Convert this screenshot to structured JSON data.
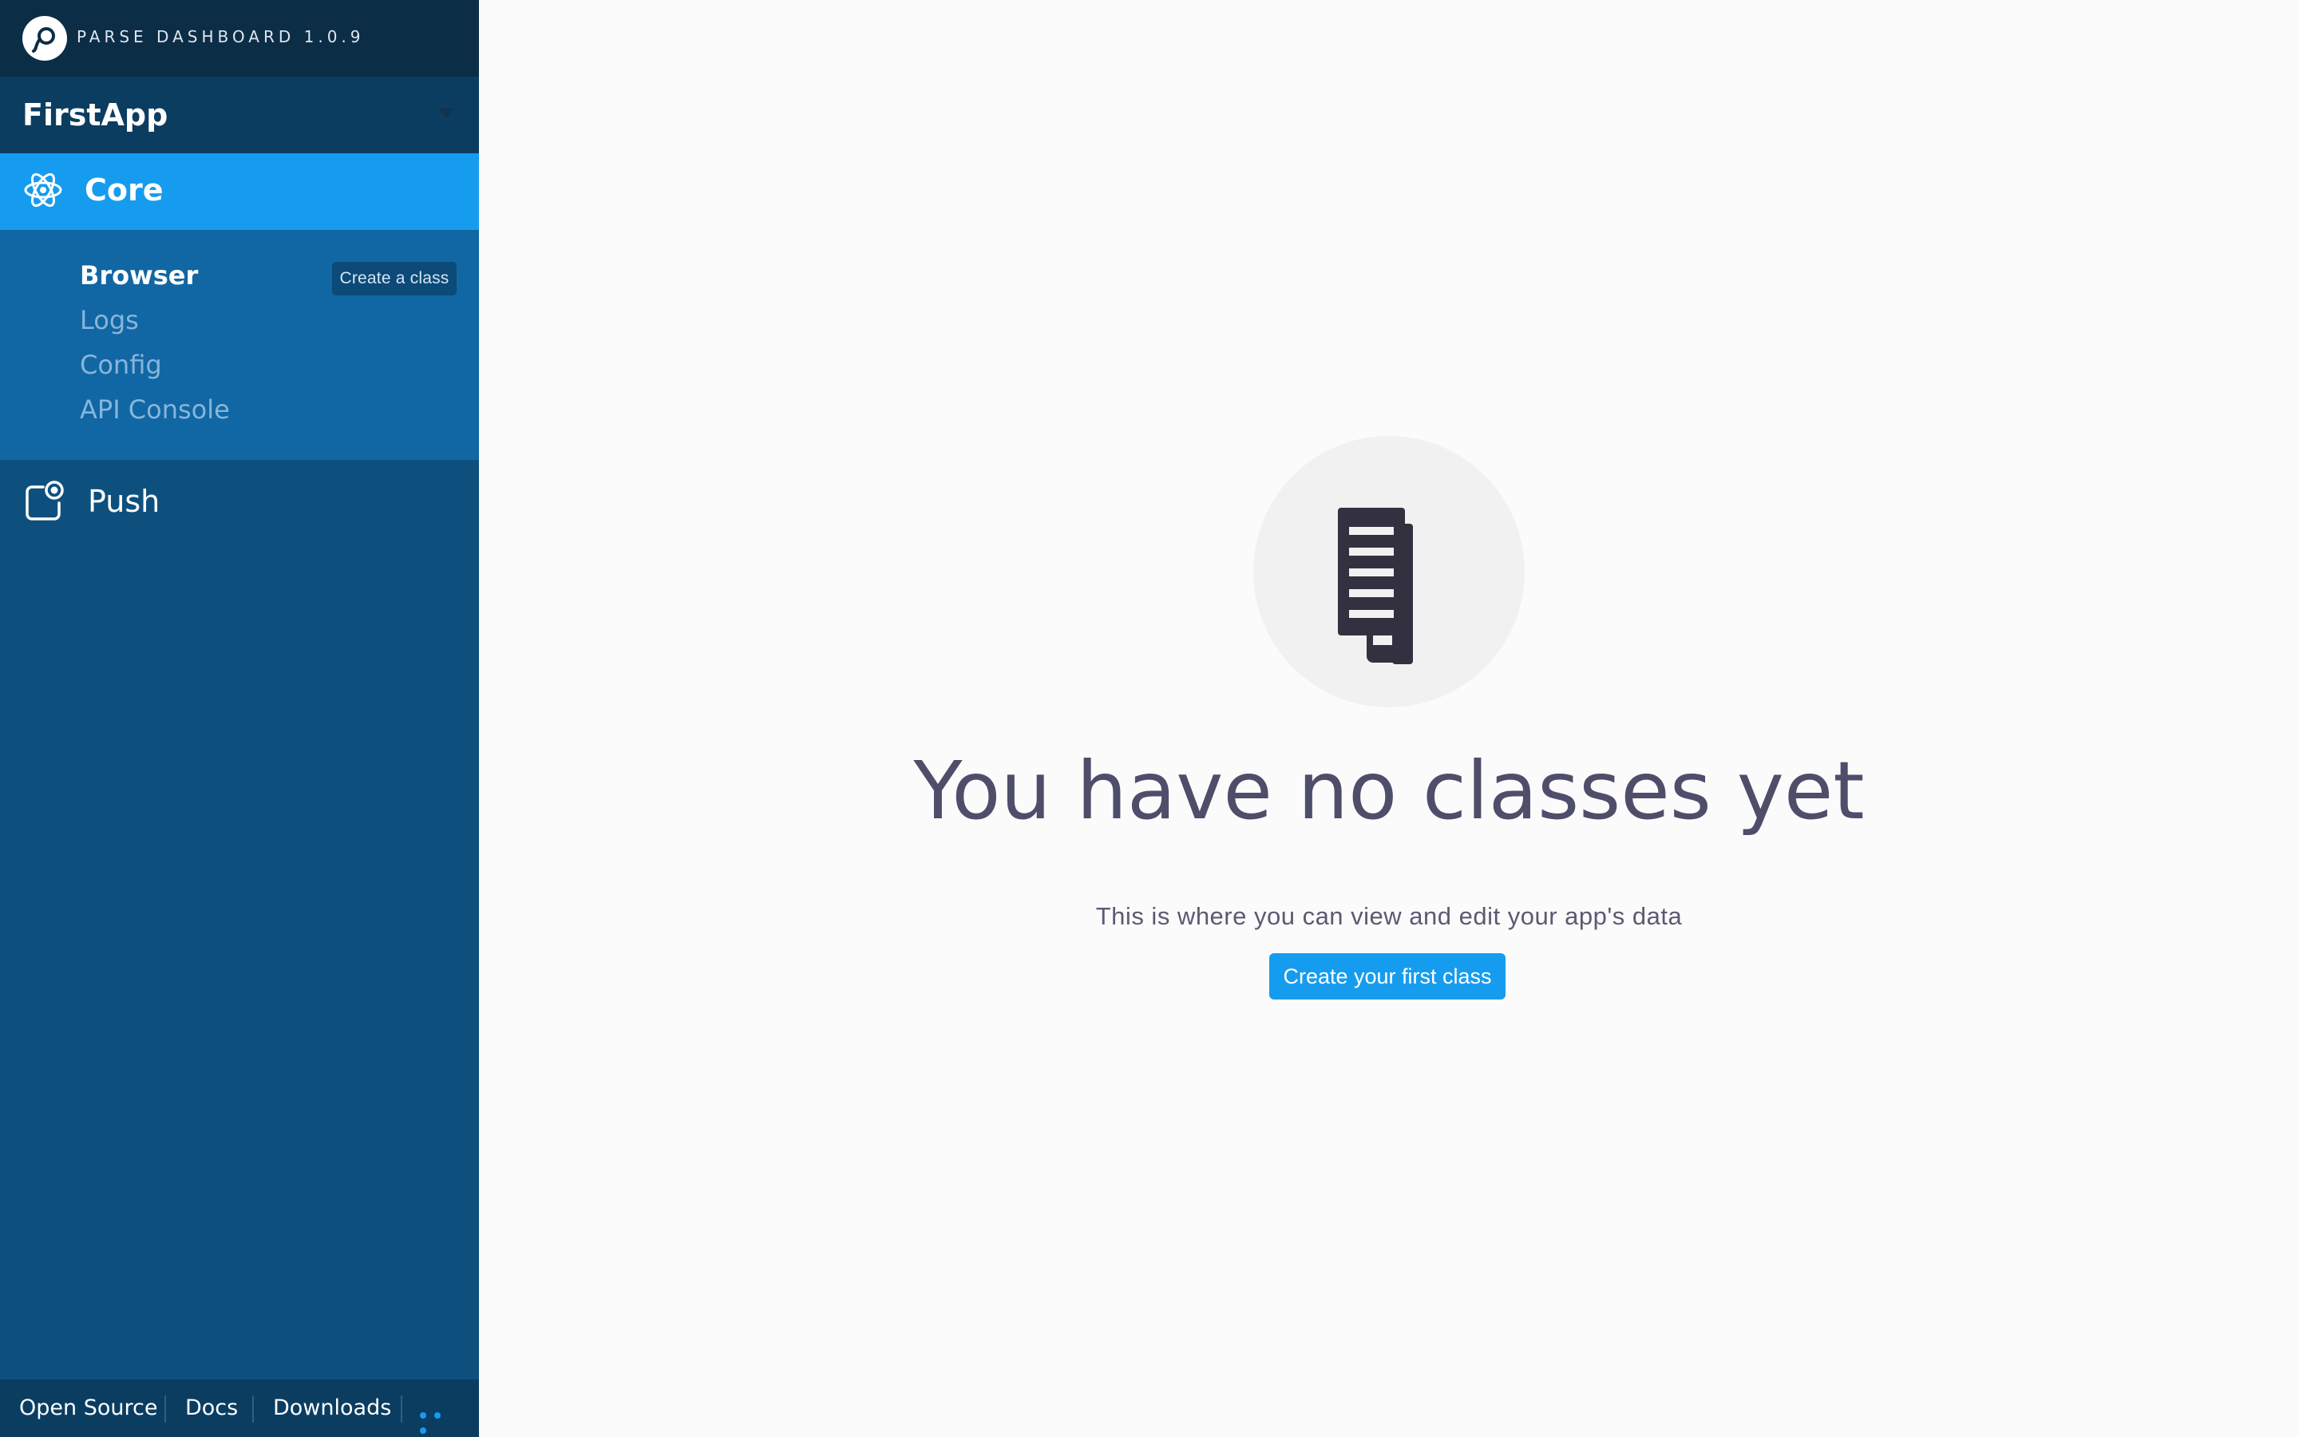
{
  "brand": {
    "name": "PARSE DASHBOARD 1.0.9",
    "icon": "parse-logo-icon"
  },
  "app_picker": {
    "selected": "FirstApp",
    "icon": "caret-down-icon"
  },
  "sidebar": {
    "sections": [
      {
        "label": "Core",
        "icon": "atom-icon",
        "active": true,
        "subitems": [
          {
            "label": "Browser",
            "active": true
          },
          {
            "label": "Logs",
            "active": false
          },
          {
            "label": "Config",
            "active": false
          },
          {
            "label": "API Console",
            "active": false
          }
        ],
        "action_label": "Create a class"
      },
      {
        "label": "Push",
        "icon": "push-notification-icon",
        "active": false
      }
    ],
    "footer": {
      "links": [
        "Open Source",
        "Docs",
        "Downloads"
      ],
      "more_icon": "more-dots-icon"
    }
  },
  "main": {
    "empty_state": {
      "icon": "documents-icon",
      "title": "You have no classes yet",
      "description": "This is where you can view and edit your app's data",
      "cta_label": "Create your first class"
    }
  },
  "colors": {
    "sidebar_bg": "#0e507d",
    "brand_bg": "#0c2d46",
    "active_section": "#169cee",
    "subnav_bg": "#1167a3",
    "accent": "#169cee",
    "title_text": "#4f4e6a"
  }
}
